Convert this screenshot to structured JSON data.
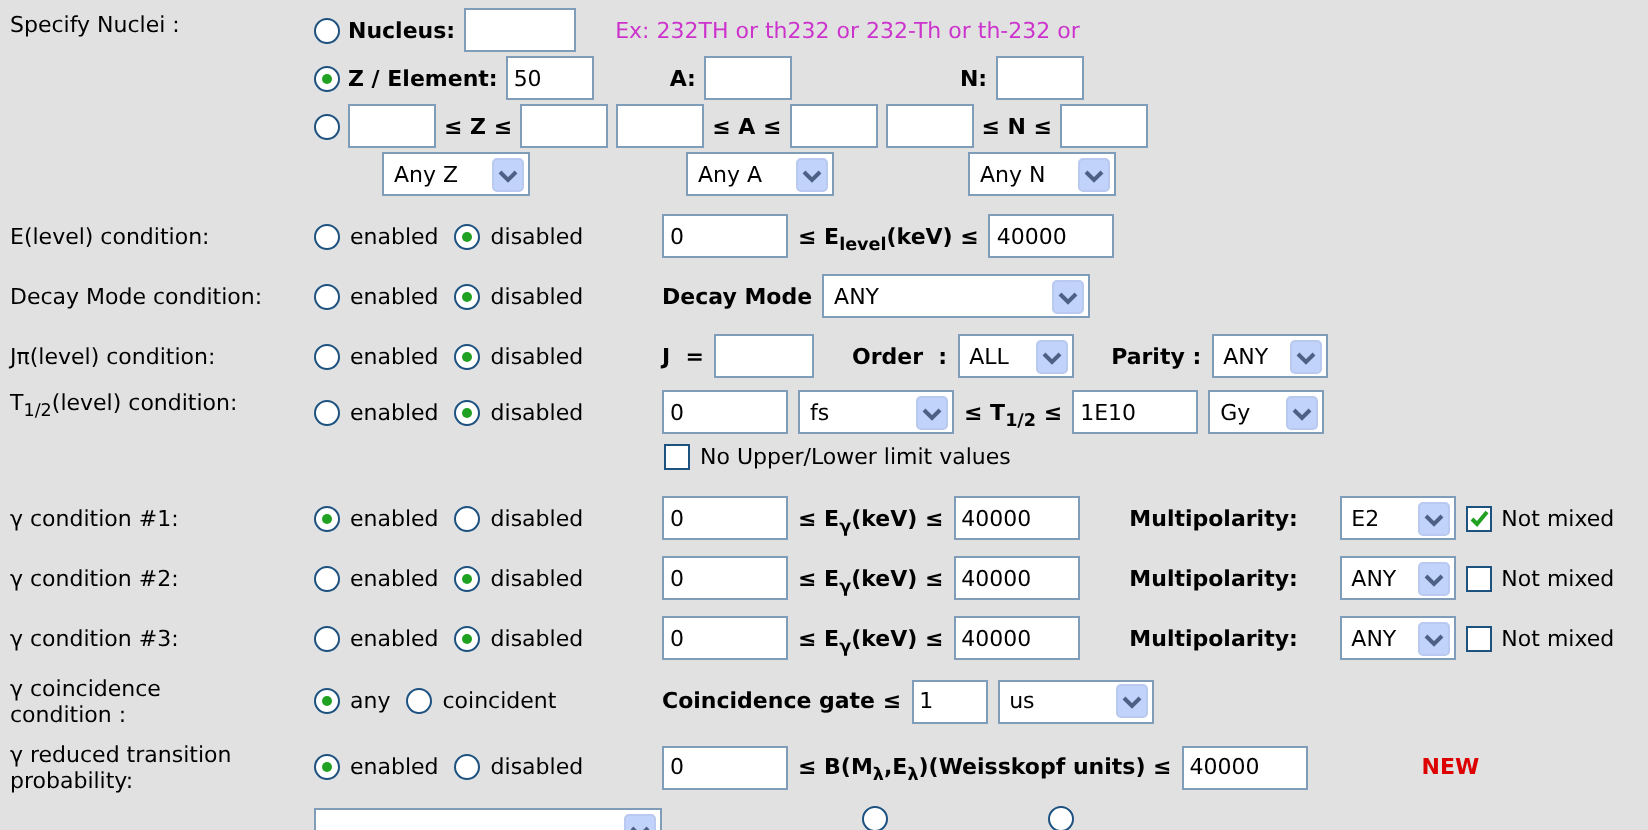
{
  "nuclei": {
    "label": "Specify Nuclei :",
    "nucleus": {
      "selected": false,
      "label": "Nucleus:",
      "hint": "Ex: 232TH or th232 or 232-Th or th-232 or"
    },
    "element": {
      "selected": true,
      "label": "Z / Element:",
      "value": "50",
      "a_label": "A:",
      "n_label": "N:"
    },
    "range": {
      "selected": false,
      "z_expr": "≤ Z ≤",
      "a_expr": "≤ A ≤",
      "n_expr": "≤ N ≤",
      "selects": [
        "Any Z",
        "Any A",
        "Any N"
      ]
    }
  },
  "conditions": [
    {
      "label": "E(level) condition:",
      "choices": [
        {
          "label": "enabled",
          "selected": false
        },
        {
          "label": "disabled",
          "selected": true
        }
      ],
      "parts": [
        {
          "kind": "field",
          "value": "0"
        },
        {
          "kind": "expr",
          "text": "≤ E$_{level}$(keV) ≤"
        },
        {
          "kind": "limit",
          "value": "40000"
        }
      ]
    },
    {
      "label": "Decay Mode condition:",
      "choices": [
        {
          "label": "enabled",
          "selected": false
        },
        {
          "label": "disabled",
          "selected": true
        }
      ],
      "parts": [
        {
          "kind": "text",
          "text": "Decay Mode"
        },
        {
          "kind": "long-select",
          "value": "ANY"
        }
      ]
    },
    {
      "label": "Jπ(level) condition:",
      "choices": [
        {
          "label": "enabled",
          "selected": false
        },
        {
          "label": "disabled",
          "selected": true
        }
      ],
      "parts": [
        {
          "kind": "text",
          "text": "J  ="
        },
        {
          "kind": "short-field"
        },
        {
          "kind": "text",
          "text": "Order  :"
        },
        {
          "kind": "select",
          "value": "ALL"
        },
        {
          "kind": "text",
          "text": "Parity :"
        },
        {
          "kind": "select",
          "value": "ANY"
        }
      ]
    },
    {
      "label": "T$_{1/2}$(level) condition:",
      "choices": [
        {
          "label": "enabled",
          "selected": false
        },
        {
          "label": "disabled",
          "selected": true
        }
      ],
      "parts": [
        {
          "kind": "field",
          "value": "0"
        },
        {
          "kind": "unit-select",
          "value": "fs"
        },
        {
          "kind": "expr",
          "text": "≤ T$_{1/2}$ ≤"
        },
        {
          "kind": "limit",
          "value": "1E10"
        },
        {
          "kind": "select",
          "value": "Gy"
        }
      ],
      "below": {
        "label": "No Upper/Lower limit values",
        "checked": false
      }
    },
    {
      "label": "γ condition #1:",
      "choices": [
        {
          "label": "enabled",
          "selected": true
        },
        {
          "label": "disabled",
          "selected": false
        }
      ],
      "parts": [
        {
          "kind": "field",
          "value": "0"
        },
        {
          "kind": "expr",
          "text": "≤ E$_{γ}$(keV) ≤"
        },
        {
          "kind": "limit",
          "value": "40000"
        },
        {
          "kind": "gap-text",
          "text": "Multipolarity:"
        },
        {
          "kind": "select",
          "value": "E2"
        },
        {
          "kind": "check",
          "label": "Not mixed",
          "checked": true
        }
      ]
    },
    {
      "label": "γ condition #2:",
      "choices": [
        {
          "label": "enabled",
          "selected": false
        },
        {
          "label": "disabled",
          "selected": true
        }
      ],
      "parts": [
        {
          "kind": "field",
          "value": "0"
        },
        {
          "kind": "expr",
          "text": "≤ E$_{γ}$(keV) ≤"
        },
        {
          "kind": "limit",
          "value": "40000"
        },
        {
          "kind": "gap-text",
          "text": "Multipolarity:"
        },
        {
          "kind": "select",
          "value": "ANY"
        },
        {
          "kind": "check",
          "label": "Not mixed",
          "checked": false
        }
      ]
    },
    {
      "label": "γ condition #3:",
      "choices": [
        {
          "label": "enabled",
          "selected": false
        },
        {
          "label": "disabled",
          "selected": true
        }
      ],
      "parts": [
        {
          "kind": "field",
          "value": "0"
        },
        {
          "kind": "expr",
          "text": "≤ E$_{γ}$(keV) ≤"
        },
        {
          "kind": "limit",
          "value": "40000"
        },
        {
          "kind": "gap-text",
          "text": "Multipolarity:"
        },
        {
          "kind": "select",
          "value": "ANY"
        },
        {
          "kind": "check",
          "label": "Not mixed",
          "checked": false
        }
      ]
    },
    {
      "label": "γ coincidence\ncondition :",
      "choices": [
        {
          "label": "any",
          "selected": true
        },
        {
          "label": "coincident",
          "selected": false
        }
      ],
      "parts": [
        {
          "kind": "text",
          "text": "Coincidence gate ≤"
        },
        {
          "kind": "gate",
          "value": "1"
        },
        {
          "kind": "unit-select",
          "value": "us"
        }
      ]
    },
    {
      "label": "γ reduced transition\nprobability:",
      "choices": [
        {
          "label": "enabled",
          "selected": true
        },
        {
          "label": "disabled",
          "selected": false
        }
      ],
      "parts": [
        {
          "kind": "field",
          "value": "0"
        },
        {
          "kind": "expr",
          "text": "≤ B(M$_{λ}$,E$_{λ}$)(Weisskopf units) ≤"
        },
        {
          "kind": "limit",
          "value": "40000"
        },
        {
          "kind": "new",
          "text": "NEW"
        }
      ]
    }
  ],
  "partial": {
    "choices": [
      {
        "selected": false
      },
      {
        "selected": false
      }
    ]
  }
}
